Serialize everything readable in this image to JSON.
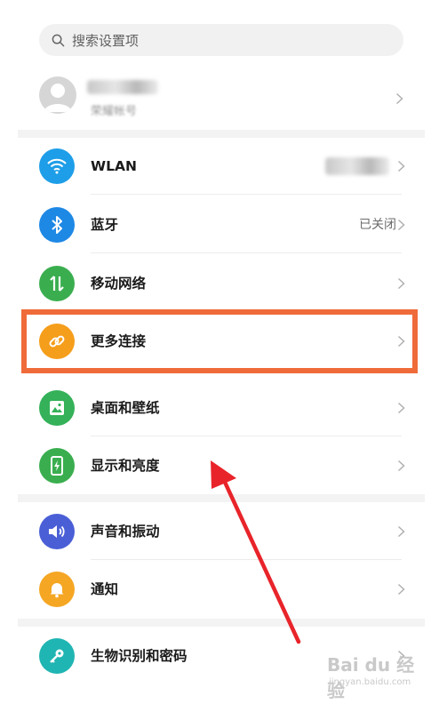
{
  "search": {
    "placeholder": "搜索设置项"
  },
  "account": {
    "name": "荣耀帐号"
  },
  "rows": [
    {
      "label": "WLAN",
      "value": "",
      "icon": "wifi-icon",
      "color": "#1e9ee8"
    },
    {
      "label": "蓝牙",
      "value": "已关闭",
      "icon": "bluetooth-icon",
      "color": "#1e88e5"
    },
    {
      "label": "移动网络",
      "value": "",
      "icon": "mobile-data-icon",
      "color": "#3aae4f"
    },
    {
      "label": "更多连接",
      "value": "",
      "icon": "link-icon",
      "color": "#f59e1b"
    },
    {
      "label": "桌面和壁纸",
      "value": "",
      "icon": "wallpaper-icon",
      "color": "#34b159"
    },
    {
      "label": "显示和亮度",
      "value": "",
      "icon": "display-icon",
      "color": "#3aae4f"
    },
    {
      "label": "声音和振动",
      "value": "",
      "icon": "volume-icon",
      "color": "#4a5fd6"
    },
    {
      "label": "通知",
      "value": "",
      "icon": "bell-icon",
      "color": "#f5a623"
    },
    {
      "label": "生物识别和密码",
      "value": "",
      "icon": "key-icon",
      "color": "#1fb5b2"
    }
  ],
  "watermark": {
    "main": "Bai du 经验",
    "sub": "jingyan.baidu.com"
  }
}
